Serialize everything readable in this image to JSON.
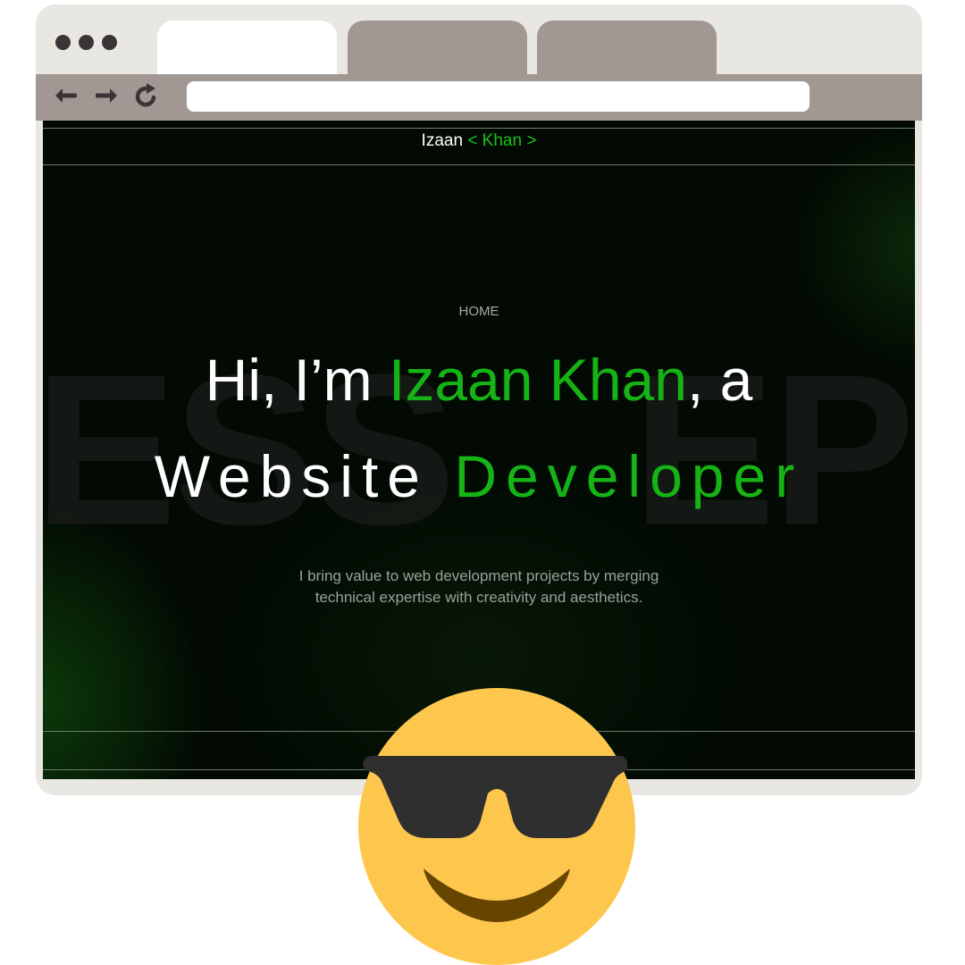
{
  "site": {
    "brand_name": "Izaan",
    "brand_accent": "< Khan >",
    "nav_home": "HOME",
    "hero": {
      "prefix": "Hi, I’m ",
      "name": "Izaan Khan",
      "suffix": ", a",
      "role_word1": "Website",
      "role_word2": "Developer"
    },
    "subtitle_line1": "I bring value to web development projects by merging",
    "subtitle_line2": "technical expertise with creativity and aesthetics.",
    "watermark_left": "ESS",
    "watermark_right": "EP"
  },
  "colors": {
    "accent_green": "#16b316",
    "background": "#020a03",
    "browser_frame": "#e8e7e2",
    "toolbar": "#a29893"
  },
  "icons": {
    "back": "back-arrow-icon",
    "forward": "forward-arrow-icon",
    "reload": "reload-icon",
    "emoji": "sunglasses-emoji-icon"
  }
}
